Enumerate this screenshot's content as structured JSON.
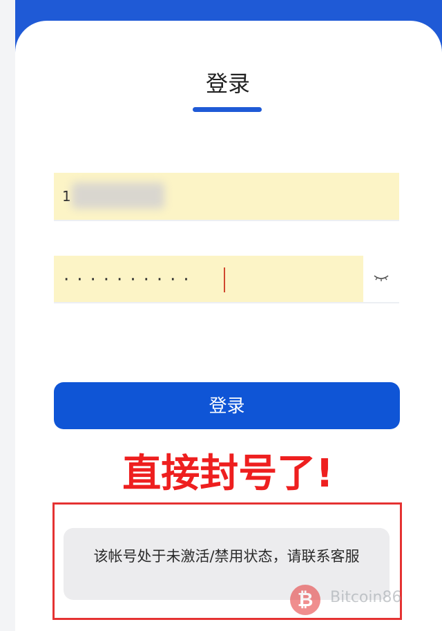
{
  "header": {
    "title": "登录"
  },
  "form": {
    "username_value": "1",
    "password_mask": "··········",
    "password_visibility_icon": "eye-closed-icon"
  },
  "login_button": {
    "label": "登录"
  },
  "annotation": {
    "text": "直接封号了!"
  },
  "error_message": {
    "text": "该帐号处于未激活/禁用状态，请联系客服"
  },
  "watermark": {
    "logo_glyph": "₿",
    "text": "Bitcoin86"
  },
  "colors": {
    "brand_blue": "#1f5ad6",
    "button_blue": "#0f55d6",
    "autofill_yellow": "#fcf4c6",
    "alert_red": "#ee1f1f"
  }
}
